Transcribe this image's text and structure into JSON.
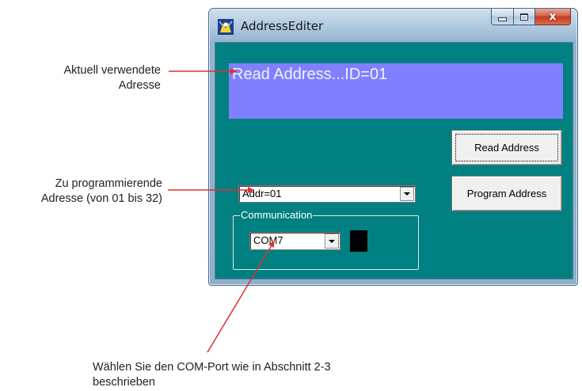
{
  "window": {
    "title": "AddressEditer",
    "id_display": "Read Address...ID=01",
    "read_button": "Read Address",
    "program_button": "Program Address",
    "address_select": "Addr=01",
    "group_label": "Communication",
    "com_select": "COM7",
    "close_glyph": "x"
  },
  "annotations": {
    "current_line1": "Aktuell verwendete",
    "current_line2": "Adresse",
    "program_line1": "Zu programmierende",
    "program_line2": "Adresse (von 01 bis 32)",
    "com_line1": "Wählen Sie den COM-Port wie in Abschnitt 2-3",
    "com_line2": "beschrieben"
  },
  "colors": {
    "client_bg": "#008080",
    "id_display_bg": "#8080ff",
    "arrow": "#e03030",
    "indicator": "#000000"
  },
  "icons": [
    "app-icon",
    "minimize-icon",
    "maximize-icon",
    "close-icon",
    "dropdown-arrow-icon"
  ]
}
